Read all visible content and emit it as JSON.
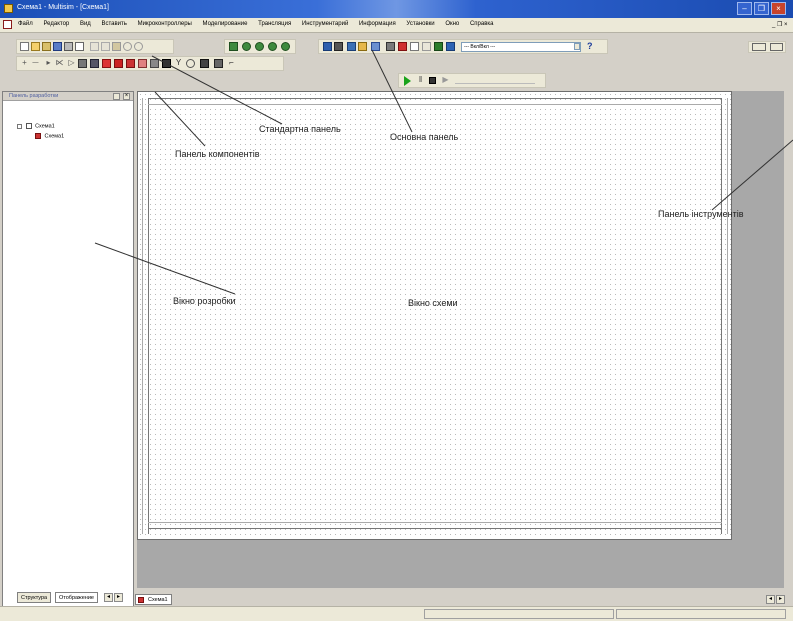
{
  "window": {
    "title": "Схема1 - Multisim - [Схема1]",
    "controls": {
      "minimize": "–",
      "restore": "❐",
      "close": "×"
    }
  },
  "menu": {
    "items": [
      "Файл",
      "Редактор",
      "Вид",
      "Вставить",
      "Микроконтроллеры",
      "Моделирование",
      "Трансляция",
      "Инструментарий",
      "Информация",
      "Установки",
      "Окно",
      "Справка"
    ],
    "mdi_controls": "_ ❐ ×"
  },
  "toolbar": {
    "in_use_list": "--- Вкл/Вкл ---",
    "help_icon": "?"
  },
  "left_panel": {
    "title": "Панель разработки",
    "tree_root": "Схема1",
    "tree_child": "Схема1",
    "tabs": [
      "Структура",
      "Отображение"
    ]
  },
  "sheet_tab": {
    "label": "Схема1"
  },
  "annotations": {
    "standard_panel": "Стандартна панель",
    "main_panel": "Основна панель",
    "component_panel": "Панель компонентів",
    "instruments_panel": "Панель інструментів",
    "dev_window": "Вікно розробки",
    "schematic_window": "Вікно схеми"
  },
  "colors": {
    "title_bar": "#1b4fb7",
    "sim_run": "#1aa31a",
    "sheet_bg": "#ffffff",
    "workspace_bg": "#a8a8a8"
  }
}
